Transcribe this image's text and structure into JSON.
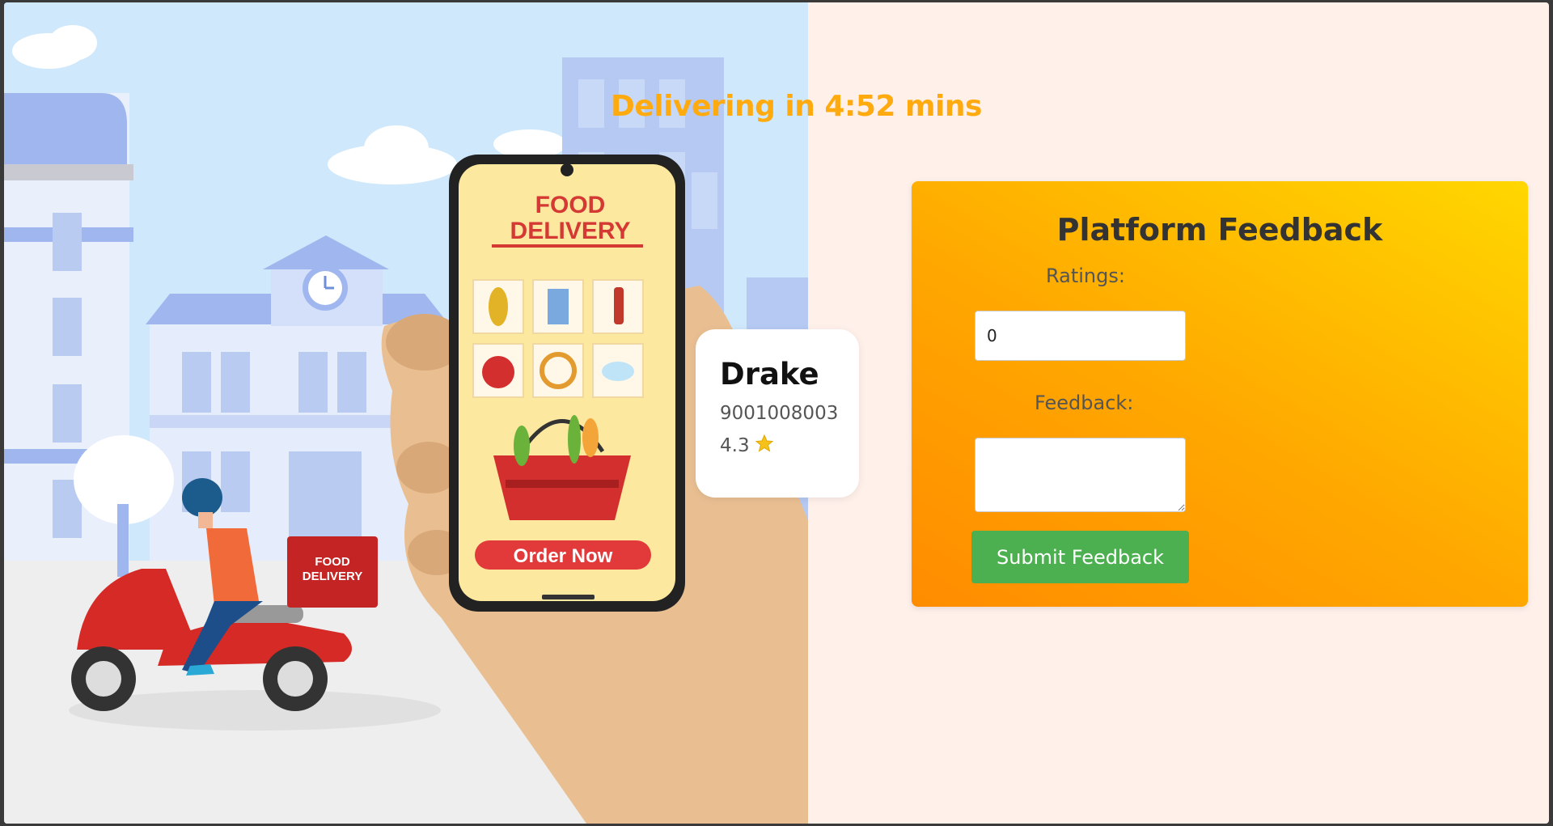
{
  "status": {
    "delivering_text": "Delivering in 4:52 mins"
  },
  "illustration": {
    "phone_title_line1": "FOOD",
    "phone_title_line2": "DELIVERY",
    "order_button": "Order Now",
    "box_line1": "FOOD",
    "box_line2": "DELIVERY"
  },
  "driver": {
    "name": "Drake",
    "phone": "9001008003",
    "rating": "4.3",
    "rating_icon": "star-icon"
  },
  "feedback_form": {
    "title": "Platform Feedback",
    "ratings_label": "Ratings:",
    "ratings_value": "0",
    "feedback_label": "Feedback:",
    "feedback_value": "",
    "submit_label": "Submit Feedback"
  },
  "colors": {
    "accent": "#ffab10",
    "submit": "#4caf50",
    "panel_gradient_start": "#ff8c00",
    "panel_gradient_end": "#ffd700",
    "page_bg": "#fff0ea"
  }
}
